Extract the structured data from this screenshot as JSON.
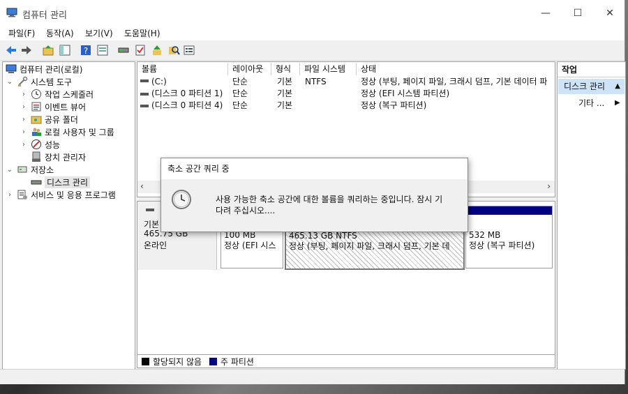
{
  "window": {
    "title": "컴퓨터 관리",
    "minimize": "—",
    "maximize": "☐",
    "close": "✕"
  },
  "menu": [
    "파일(F)",
    "동작(A)",
    "보기(V)",
    "도움말(H)"
  ],
  "toolbar_icons": [
    "back-arrow-icon",
    "forward-arrow-icon",
    "up-folder-icon",
    "show-hide-tree-icon",
    "help-icon",
    "properties-icon",
    "disk-icon",
    "checklist-icon",
    "arrow-up-icon",
    "search-icon",
    "list-icon"
  ],
  "tree": {
    "root": "컴퓨터 관리(로컬)",
    "system_tools": "시스템 도구",
    "task_scheduler": "작업 스케줄러",
    "event_viewer": "이벤트 뷰어",
    "shared_folders": "공유 폴더",
    "local_users": "로컬 사용자 및 그룹",
    "performance": "성능",
    "device_manager": "장치 관리자",
    "storage": "저장소",
    "disk_management": "디스크 관리",
    "services": "서비스 및 응용 프로그램"
  },
  "volume_list": {
    "columns": [
      "볼륨",
      "레이아웃",
      "형식",
      "파일 시스템",
      "상태"
    ],
    "rows": [
      {
        "volume": "(C:)",
        "layout": "단순",
        "type": "기본",
        "fs": "NTFS",
        "status": "정상 (부팅, 페이지 파일, 크래시 덤프, 기본 데이터 파"
      },
      {
        "volume": "(디스크 0 파티션 1)",
        "layout": "단순",
        "type": "기본",
        "fs": "",
        "status": "정상 (EFI 시스템 파티션)"
      },
      {
        "volume": "(디스크 0 파티션 4)",
        "layout": "단순",
        "type": "기본",
        "fs": "",
        "status": "정상 (복구 파티션)"
      }
    ]
  },
  "disk": {
    "type": "기본",
    "size": "465.75 GB",
    "state": "온라인",
    "partitions": [
      {
        "size": "100 MB",
        "status": "정상 (EFI 시스"
      },
      {
        "size": "465.13 GB NTFS",
        "status": "정상 (부팅, 페이지 파일, 크래시 덤프, 기본 데"
      },
      {
        "size": "532 MB",
        "status": "정상 (복구 파티션)"
      }
    ]
  },
  "legend": {
    "unallocated": "할당되지 않음",
    "primary": "주 파티션",
    "unallocated_color": "#000000",
    "primary_color": "#000080"
  },
  "actions": {
    "header": "작업",
    "selected": "디스크 관리",
    "more": "기타 ..."
  },
  "dialog": {
    "title": "축소 공간 쿼리 중",
    "message_line1": "사용 가능한 축소 공간에 대한 볼륨을 쿼리하는 중입니다. 잠시 기",
    "message_line2": "다려 주십시오...."
  }
}
